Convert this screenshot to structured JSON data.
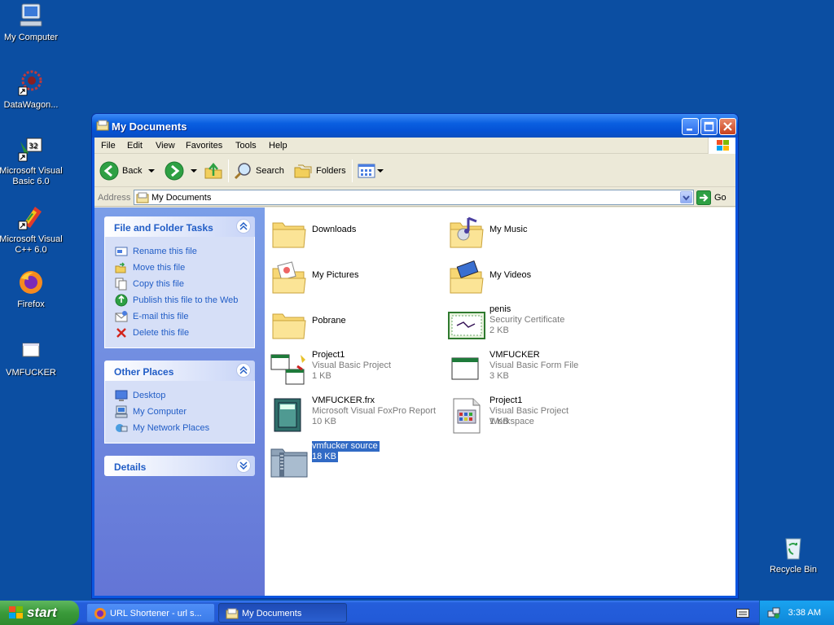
{
  "desktop": {
    "icons": [
      {
        "label": "My Computer",
        "icon": "my-computer-icon"
      },
      {
        "label": "DataWagon...",
        "icon": "datawagon-shortcut-icon"
      },
      {
        "label": "Microsoft Visual Basic 6.0",
        "icon": "visual-basic-icon"
      },
      {
        "label": "Microsoft Visual C++ 6.0",
        "icon": "visual-cpp-icon"
      },
      {
        "label": "Firefox",
        "icon": "firefox-icon"
      },
      {
        "label": "VMFUCKER",
        "icon": "exe-file-icon"
      },
      {
        "label": "Recycle Bin",
        "icon": "recycle-bin-icon"
      }
    ]
  },
  "window": {
    "title": "My Documents",
    "menu": [
      "File",
      "Edit",
      "View",
      "Favorites",
      "Tools",
      "Help"
    ],
    "toolbar": {
      "back": "Back",
      "search": "Search",
      "folders": "Folders"
    },
    "address": {
      "label": "Address",
      "value": "My Documents",
      "go": "Go"
    },
    "tasks": {
      "file_folder": {
        "title": "File and Folder Tasks",
        "items": [
          "Rename this file",
          "Move this file",
          "Copy this file",
          "Publish this file to the Web",
          "E-mail this file",
          "Delete this file"
        ]
      },
      "other_places": {
        "title": "Other Places",
        "items": [
          "Desktop",
          "My Computer",
          "My Network Places"
        ]
      },
      "details": {
        "title": "Details"
      }
    },
    "files": [
      {
        "name": "Downloads",
        "type": "",
        "size": "",
        "icon": "folder-icon"
      },
      {
        "name": "My Music",
        "type": "",
        "size": "",
        "icon": "music-folder-icon"
      },
      {
        "name": "My Pictures",
        "type": "",
        "size": "",
        "icon": "pictures-folder-icon"
      },
      {
        "name": "My Videos",
        "type": "",
        "size": "",
        "icon": "videos-folder-icon"
      },
      {
        "name": "Pobrane",
        "type": "",
        "size": "",
        "icon": "folder-icon"
      },
      {
        "name": "penis",
        "type": "Security Certificate",
        "size": "2 KB",
        "icon": "certificate-icon"
      },
      {
        "name": "Project1",
        "type": "Visual Basic Project",
        "size": "1 KB",
        "icon": "vb-project-icon"
      },
      {
        "name": "VMFUCKER",
        "type": "Visual Basic Form File",
        "size": "3 KB",
        "icon": "vb-form-icon"
      },
      {
        "name": "VMFUCKER.frx",
        "type": "Microsoft Visual FoxPro Report",
        "size": "10 KB",
        "icon": "foxpro-report-icon"
      },
      {
        "name": "Project1",
        "type": "Visual Basic Project Workspace",
        "size": "1 KB",
        "icon": "vb-workspace-icon"
      },
      {
        "name": "vmfucker source",
        "type": "",
        "size": "18 KB",
        "icon": "zip-folder-icon"
      }
    ]
  },
  "taskbar": {
    "start": "start",
    "tasks": [
      "URL Shortener - url s...",
      "My Documents"
    ],
    "clock": "3:38 AM"
  }
}
